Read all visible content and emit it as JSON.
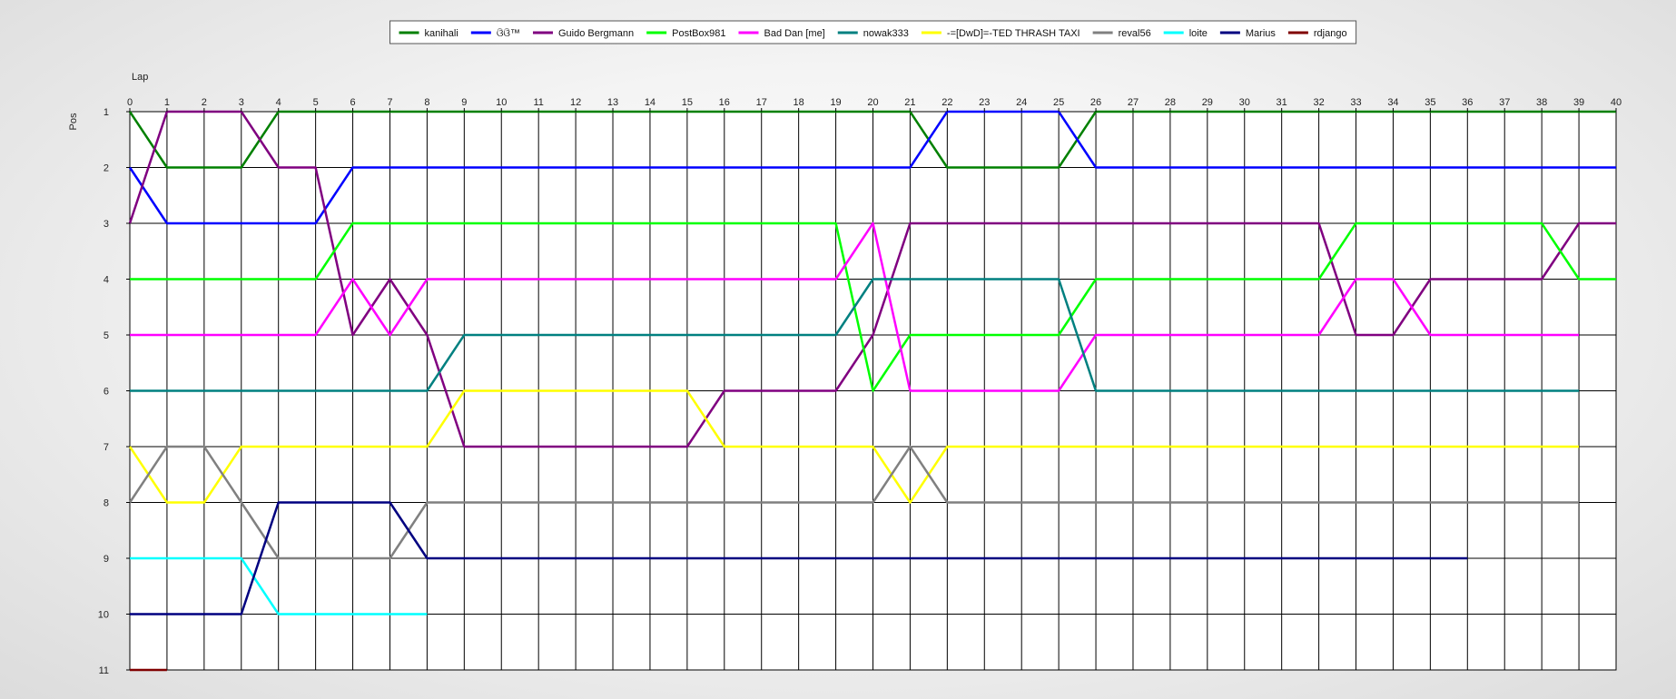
{
  "chart_data": {
    "type": "line",
    "title": "",
    "xlabel": "Lap",
    "ylabel": "Pos",
    "xlim": [
      0,
      40
    ],
    "ylim": [
      1,
      11
    ],
    "y_inverted": true,
    "grid": true,
    "legend_position": "top-center",
    "x_ticks": [
      0,
      1,
      2,
      3,
      4,
      5,
      6,
      7,
      8,
      9,
      10,
      11,
      12,
      13,
      14,
      15,
      16,
      17,
      18,
      19,
      20,
      21,
      22,
      23,
      24,
      25,
      26,
      27,
      28,
      29,
      30,
      31,
      32,
      33,
      34,
      35,
      36,
      37,
      38,
      39,
      40
    ],
    "y_ticks": [
      1,
      2,
      3,
      4,
      5,
      6,
      7,
      8,
      9,
      10,
      11
    ],
    "series": [
      {
        "name": "kanihali",
        "color": "#008000",
        "x": [
          0,
          1,
          2,
          3,
          4,
          5,
          6,
          7,
          8,
          9,
          10,
          11,
          12,
          13,
          14,
          15,
          16,
          17,
          18,
          19,
          20,
          21,
          22,
          23,
          24,
          25,
          26,
          27,
          28,
          29,
          30,
          31,
          32,
          33,
          34,
          35,
          36,
          37,
          38,
          39,
          40
        ],
        "y": [
          1,
          2,
          2,
          2,
          1,
          1,
          1,
          1,
          1,
          1,
          1,
          1,
          1,
          1,
          1,
          1,
          1,
          1,
          1,
          1,
          1,
          1,
          2,
          2,
          2,
          2,
          1,
          1,
          1,
          1,
          1,
          1,
          1,
          1,
          1,
          1,
          1,
          1,
          1,
          1,
          1
        ]
      },
      {
        "name": "ଓିଓି™",
        "color": "#0000ff",
        "x": [
          0,
          1,
          2,
          3,
          4,
          5,
          6,
          7,
          8,
          9,
          10,
          11,
          12,
          13,
          14,
          15,
          16,
          17,
          18,
          19,
          20,
          21,
          22,
          23,
          24,
          25,
          26,
          27,
          28,
          29,
          30,
          31,
          32,
          33,
          34,
          35,
          36,
          37,
          38,
          39,
          40
        ],
        "y": [
          2,
          3,
          3,
          3,
          3,
          3,
          2,
          2,
          2,
          2,
          2,
          2,
          2,
          2,
          2,
          2,
          2,
          2,
          2,
          2,
          2,
          2,
          1,
          1,
          1,
          1,
          2,
          2,
          2,
          2,
          2,
          2,
          2,
          2,
          2,
          2,
          2,
          2,
          2,
          2,
          2
        ]
      },
      {
        "name": "Guido Bergmann",
        "color": "#800080",
        "x": [
          0,
          1,
          2,
          3,
          4,
          5,
          6,
          7,
          8,
          9,
          10,
          11,
          12,
          13,
          14,
          15,
          16,
          17,
          18,
          19,
          20,
          21,
          22,
          23,
          24,
          25,
          26,
          27,
          28,
          29,
          30,
          31,
          32,
          33,
          34,
          35,
          36,
          37,
          38,
          39,
          40
        ],
        "y": [
          3,
          1,
          1,
          1,
          2,
          2,
          5,
          4,
          5,
          7,
          7,
          7,
          7,
          7,
          7,
          7,
          6,
          6,
          6,
          6,
          5,
          3,
          3,
          3,
          3,
          3,
          3,
          3,
          3,
          3,
          3,
          3,
          3,
          5,
          5,
          4,
          4,
          4,
          4,
          3,
          3
        ]
      },
      {
        "name": "PostBox981",
        "color": "#00ff00",
        "x": [
          0,
          1,
          2,
          3,
          4,
          5,
          6,
          7,
          8,
          9,
          10,
          11,
          12,
          13,
          14,
          15,
          16,
          17,
          18,
          19,
          20,
          21,
          22,
          23,
          24,
          25,
          26,
          27,
          28,
          29,
          30,
          31,
          32,
          33,
          34,
          35,
          36,
          37,
          38,
          39,
          40
        ],
        "y": [
          4,
          4,
          4,
          4,
          4,
          4,
          3,
          3,
          3,
          3,
          3,
          3,
          3,
          3,
          3,
          3,
          3,
          3,
          3,
          3,
          6,
          5,
          5,
          5,
          5,
          5,
          4,
          4,
          4,
          4,
          4,
          4,
          4,
          3,
          3,
          3,
          3,
          3,
          3,
          4,
          4
        ]
      },
      {
        "name": "Bad Dan [me]",
        "color": "#ff00ff",
        "x": [
          0,
          1,
          2,
          3,
          4,
          5,
          6,
          7,
          8,
          9,
          10,
          11,
          12,
          13,
          14,
          15,
          16,
          17,
          18,
          19,
          20,
          21,
          22,
          23,
          24,
          25,
          26,
          27,
          28,
          29,
          30,
          31,
          32,
          33,
          34,
          35,
          36,
          37,
          38,
          39
        ],
        "y": [
          5,
          5,
          5,
          5,
          5,
          5,
          4,
          5,
          4,
          4,
          4,
          4,
          4,
          4,
          4,
          4,
          4,
          4,
          4,
          4,
          3,
          6,
          6,
          6,
          6,
          6,
          5,
          5,
          5,
          5,
          5,
          5,
          5,
          4,
          4,
          5,
          5,
          5,
          5,
          5
        ]
      },
      {
        "name": "nowak333",
        "color": "#008080",
        "x": [
          0,
          1,
          2,
          3,
          4,
          5,
          6,
          7,
          8,
          9,
          10,
          11,
          12,
          13,
          14,
          15,
          16,
          17,
          18,
          19,
          20,
          21,
          22,
          23,
          24,
          25,
          26,
          27,
          28,
          29,
          30,
          31,
          32,
          33,
          34,
          35,
          36,
          37,
          38,
          39
        ],
        "y": [
          6,
          6,
          6,
          6,
          6,
          6,
          6,
          6,
          6,
          5,
          5,
          5,
          5,
          5,
          5,
          5,
          5,
          5,
          5,
          5,
          4,
          4,
          4,
          4,
          4,
          4,
          6,
          6,
          6,
          6,
          6,
          6,
          6,
          6,
          6,
          6,
          6,
          6,
          6,
          6
        ]
      },
      {
        "name": "-=[DwD]=-TED THRASH TAXI",
        "color": "#ffff00",
        "x": [
          0,
          1,
          2,
          3,
          4,
          5,
          6,
          7,
          8,
          9,
          10,
          11,
          12,
          13,
          14,
          15,
          16,
          17,
          18,
          19,
          20,
          21,
          22,
          23,
          24,
          25,
          26,
          27,
          28,
          29,
          30,
          31,
          32,
          33,
          34,
          35,
          36,
          37,
          38,
          39
        ],
        "y": [
          7,
          8,
          8,
          7,
          7,
          7,
          7,
          7,
          7,
          6,
          6,
          6,
          6,
          6,
          6,
          6,
          7,
          7,
          7,
          7,
          7,
          8,
          7,
          7,
          7,
          7,
          7,
          7,
          7,
          7,
          7,
          7,
          7,
          7,
          7,
          7,
          7,
          7,
          7,
          7
        ]
      },
      {
        "name": "reval56",
        "color": "#808080",
        "x": [
          0,
          1,
          2,
          3,
          4,
          5,
          6,
          7,
          8,
          9,
          10,
          11,
          12,
          13,
          14,
          15,
          16,
          17,
          18,
          19,
          20,
          21,
          22,
          23,
          24,
          25,
          26,
          27,
          28,
          29,
          30,
          31,
          32,
          33,
          34,
          35,
          36,
          37,
          38,
          39
        ],
        "y": [
          8,
          7,
          7,
          8,
          9,
          9,
          9,
          9,
          8,
          8,
          8,
          8,
          8,
          8,
          8,
          8,
          8,
          8,
          8,
          8,
          8,
          7,
          8,
          8,
          8,
          8,
          8,
          8,
          8,
          8,
          8,
          8,
          8,
          8,
          8,
          8,
          8,
          8,
          8,
          8
        ]
      },
      {
        "name": "loite",
        "color": "#00ffff",
        "x": [
          0,
          1,
          2,
          3,
          4,
          5,
          6,
          7,
          8
        ],
        "y": [
          9,
          9,
          9,
          9,
          10,
          10,
          10,
          10,
          10
        ]
      },
      {
        "name": "Marius",
        "color": "#000080",
        "x": [
          0,
          1,
          2,
          3,
          4,
          5,
          6,
          7,
          8,
          9,
          10,
          11,
          12,
          13,
          14,
          15,
          16,
          17,
          18,
          19,
          20,
          21,
          22,
          23,
          24,
          25,
          26,
          27,
          28,
          29,
          30,
          31,
          32,
          33,
          34,
          35,
          36
        ],
        "y": [
          10,
          10,
          10,
          10,
          8,
          8,
          8,
          8,
          9,
          9,
          9,
          9,
          9,
          9,
          9,
          9,
          9,
          9,
          9,
          9,
          9,
          9,
          9,
          9,
          9,
          9,
          9,
          9,
          9,
          9,
          9,
          9,
          9,
          9,
          9,
          9,
          9
        ]
      },
      {
        "name": "rdjango",
        "color": "#800000",
        "x": [
          0,
          1
        ],
        "y": [
          11,
          11
        ]
      }
    ]
  }
}
